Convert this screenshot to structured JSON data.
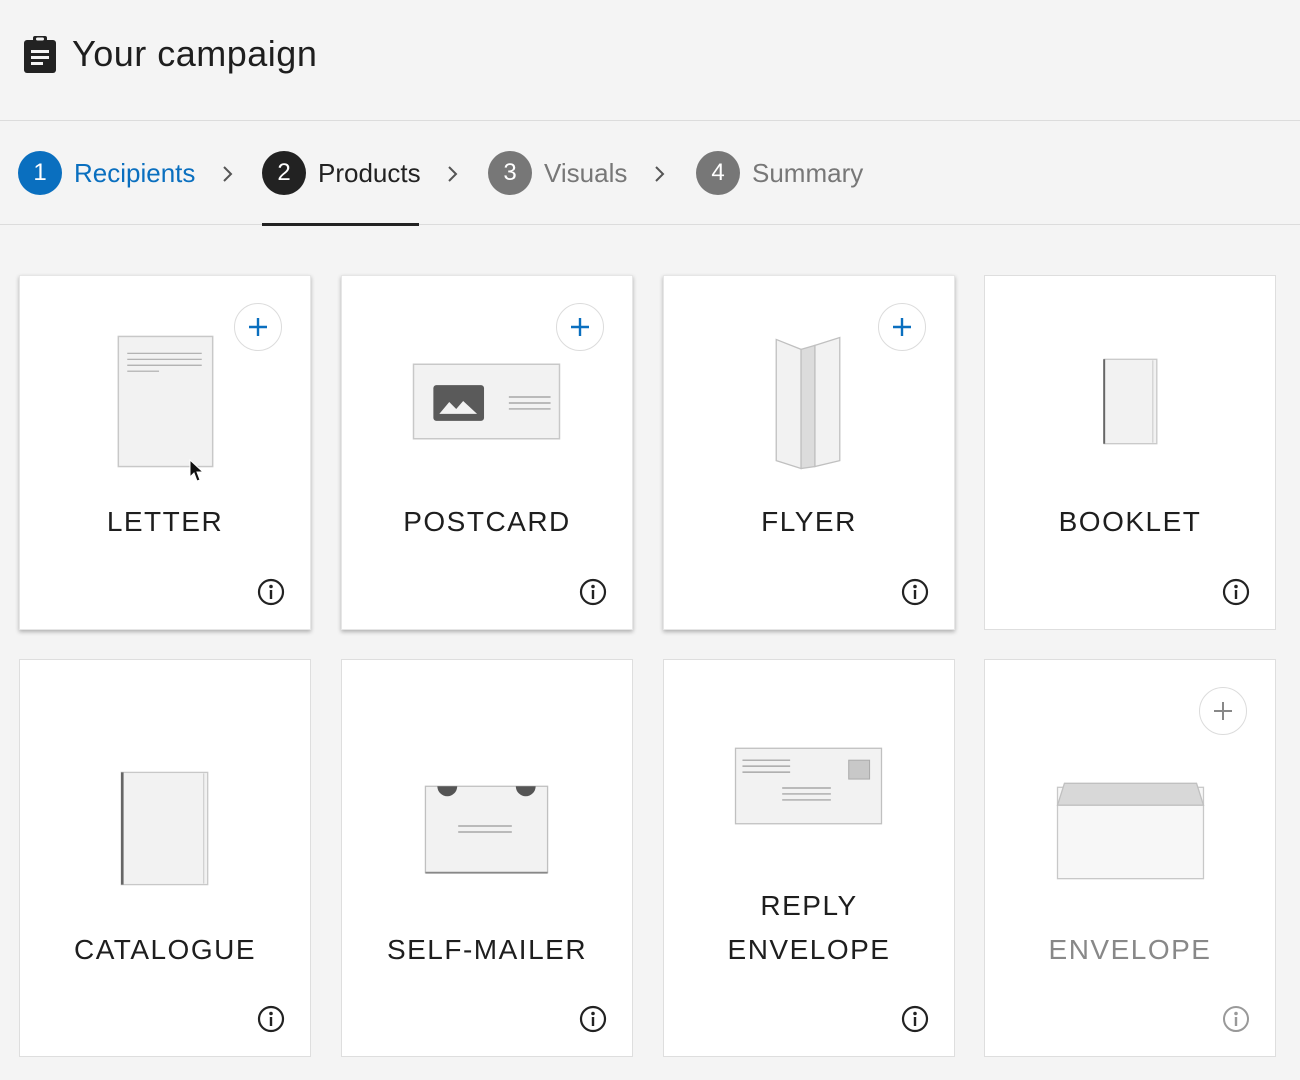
{
  "header": {
    "title": "Your campaign",
    "icon": "clipboard-icon"
  },
  "stepper": {
    "steps": [
      {
        "number": "1",
        "label": "Recipients",
        "state": "done"
      },
      {
        "number": "2",
        "label": "Products",
        "state": "active"
      },
      {
        "number": "3",
        "label": "Visuals",
        "state": "upcoming"
      },
      {
        "number": "4",
        "label": "Summary",
        "state": "upcoming"
      }
    ]
  },
  "products": [
    {
      "name": "LETTER",
      "addable": true,
      "icon": "letter-illustration"
    },
    {
      "name": "POSTCARD",
      "addable": true,
      "icon": "postcard-illustration"
    },
    {
      "name": "FLYER",
      "addable": true,
      "icon": "flyer-illustration"
    },
    {
      "name": "BOOKLET",
      "addable": false,
      "icon": "booklet-illustration"
    },
    {
      "name": "CATALOGUE",
      "addable": false,
      "icon": "catalogue-illustration"
    },
    {
      "name": "SELF-MAILER",
      "addable": false,
      "icon": "self-mailer-illustration"
    },
    {
      "name_line1": "REPLY",
      "name_line2": "ENVELOPE",
      "addable": false,
      "icon": "reply-envelope-illustration"
    },
    {
      "name": "ENVELOPE",
      "addable": true,
      "disabled": true,
      "icon": "envelope-illustration"
    }
  ],
  "colors": {
    "accent": "#0a6fbf",
    "active": "#222222",
    "upcoming": "#777777",
    "background": "#f4f4f4"
  }
}
